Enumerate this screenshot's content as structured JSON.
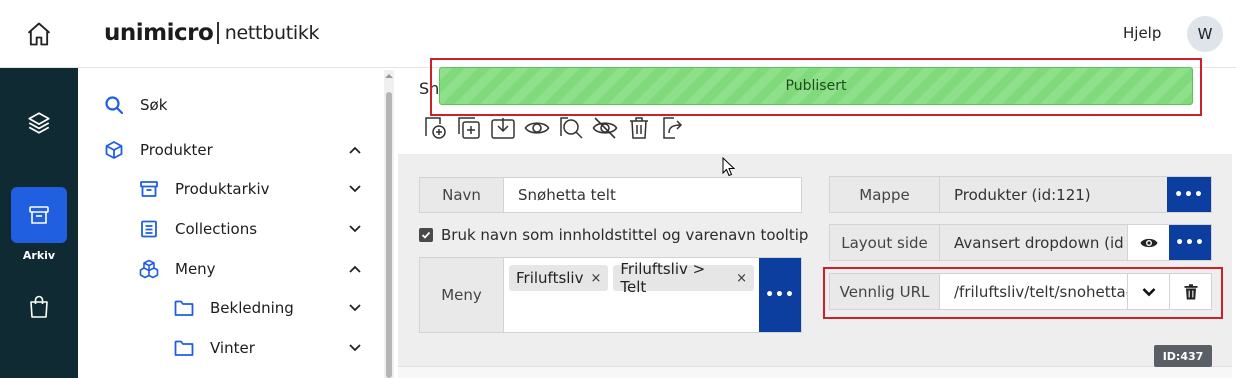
{
  "header": {
    "brand_main": "unimicro",
    "brand_sub": "nettbutikk",
    "help_label": "Hjelp",
    "avatar_initial": "W"
  },
  "rail": {
    "items": [
      {
        "icon": "layers-icon"
      },
      {
        "icon": "archive-icon",
        "label": "Arkiv",
        "active": true
      },
      {
        "icon": "shopping-bag-icon"
      }
    ]
  },
  "sidebar": {
    "items": [
      {
        "label": "Søk",
        "icon": "search-icon"
      },
      {
        "label": "Produkter",
        "icon": "cube-icon",
        "expanded": true
      },
      {
        "label": "Produktarkiv",
        "icon": "archive-box-icon",
        "expanded": false
      },
      {
        "label": "Collections",
        "icon": "list-icon",
        "expanded": false
      },
      {
        "label": "Meny",
        "icon": "cubes-icon",
        "expanded": true
      },
      {
        "label": "Bekledning",
        "icon": "folder-icon",
        "expanded": false
      },
      {
        "label": "Vinter",
        "icon": "folder-icon",
        "expanded": false
      }
    ]
  },
  "page": {
    "title_partial": "Sn"
  },
  "toast": {
    "message": "Publisert"
  },
  "form": {
    "navn_label": "Navn",
    "navn_value": "Snøhetta telt",
    "checkbox_label": "Bruk navn som innholdstittel og varenavn tooltip",
    "checkbox_checked": true,
    "meny_label": "Meny",
    "meny_tags": [
      "Friluftsliv",
      "Friluftsliv > Telt"
    ],
    "mappe_label": "Mappe",
    "mappe_value": "Produkter (id:121)",
    "layout_label": "Layout side",
    "layout_value": "Avansert dropdown (id",
    "url_label": "Vennlig URL",
    "url_value": "/friluftsliv/telt/snohetta-t",
    "id_badge": "ID:437"
  },
  "colors": {
    "rail_bg": "#0f2a33",
    "accent_blue": "#1f5fe0",
    "action_blue": "#0c3e9f",
    "toast_green": "#8fe08a",
    "highlight_red": "#cc2129"
  }
}
